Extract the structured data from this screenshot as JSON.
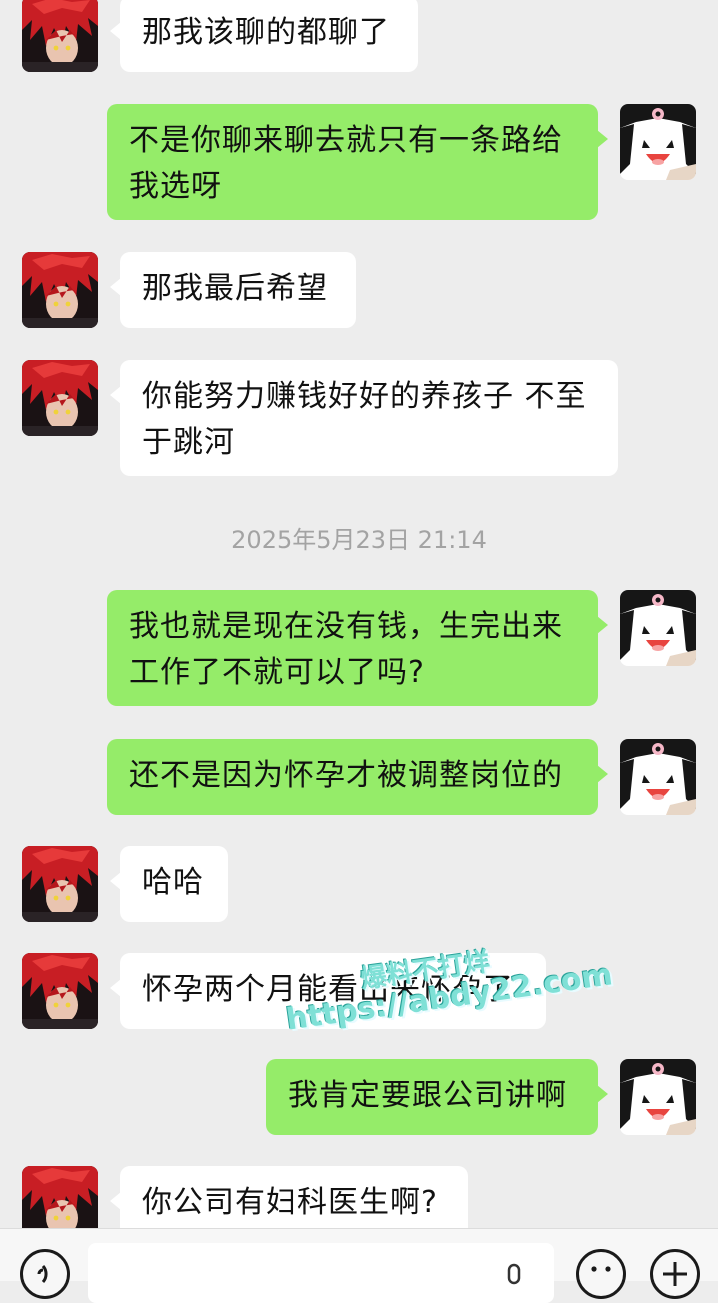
{
  "messages": [
    {
      "side": "in",
      "text": "那我该聊的都聊了"
    },
    {
      "side": "out",
      "text": "不是你聊来聊去就只有一条路给我选呀"
    },
    {
      "side": "in",
      "text": "那我最后希望"
    },
    {
      "side": "in",
      "text": "你能努力赚钱好好的养孩子 不至于跳河"
    },
    {
      "side": "out",
      "text": "我也就是现在没有钱，生完出来工作了不就可以了吗?"
    },
    {
      "side": "out",
      "text": "还不是因为怀孕才被调整岗位的"
    },
    {
      "side": "in",
      "text": "哈哈"
    },
    {
      "side": "in",
      "text": "怀孕两个月能看出来怀孕了"
    },
    {
      "side": "out",
      "text": "我肯定要跟公司讲啊"
    },
    {
      "side": "in",
      "text": "你公司有妇科医生啊?"
    }
  ],
  "timestamp": "2025年5月23日 21:14",
  "watermark": {
    "line1": "爆料不打烊",
    "line2": "https://abdy22.com"
  },
  "bottom_bar": {
    "voice_icon": "voice-icon",
    "emoji_icon": "emoji-icon",
    "plus_icon": "plus-icon",
    "mic_icon": "mic-icon"
  },
  "colors": {
    "background": "#ededed",
    "incoming_bubble": "#ffffff",
    "outgoing_bubble": "#95ec69",
    "timestamp_text": "#a3a3a3"
  }
}
